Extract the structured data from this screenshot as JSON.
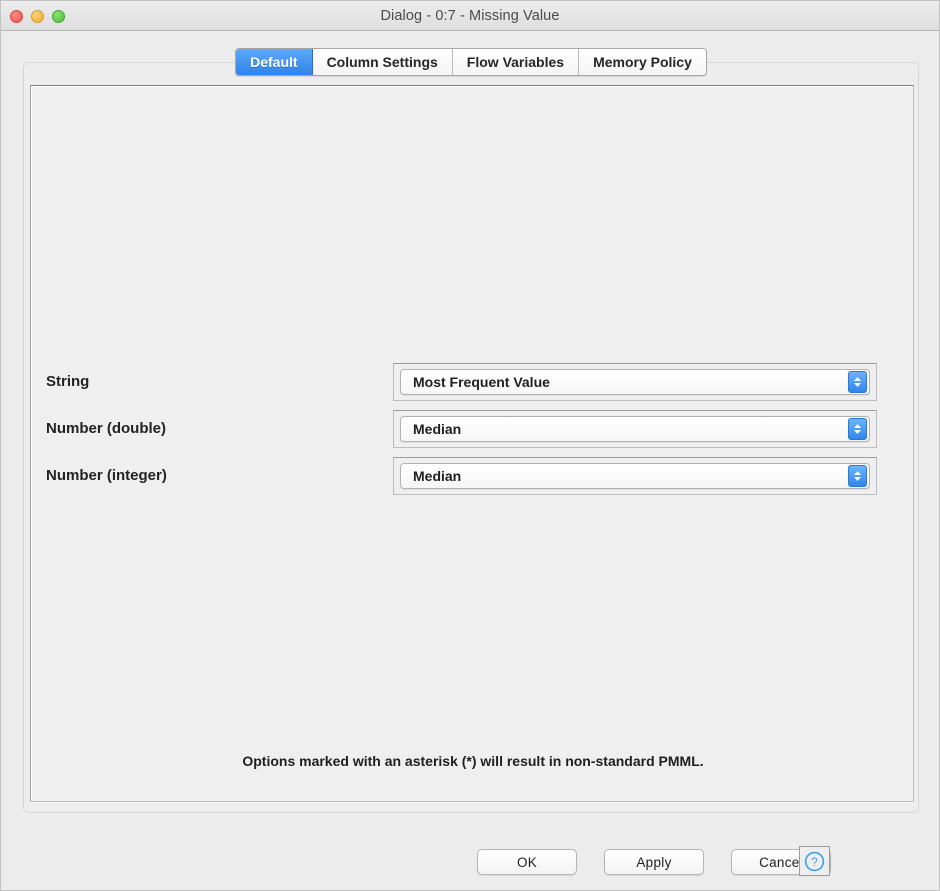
{
  "window": {
    "title": "Dialog - 0:7 - Missing Value",
    "traffic_lights": {
      "close_label": "close",
      "minimize_label": "minimize",
      "zoom_label": "zoom"
    }
  },
  "tabs": [
    {
      "label": "Default",
      "selected": true
    },
    {
      "label": "Column Settings",
      "selected": false
    },
    {
      "label": "Flow Variables",
      "selected": false
    },
    {
      "label": "Memory Policy",
      "selected": false
    }
  ],
  "settings": {
    "rows": [
      {
        "label": "String",
        "value": "Most Frequent Value"
      },
      {
        "label": "Number (double)",
        "value": "Median"
      },
      {
        "label": "Number (integer)",
        "value": "Median"
      }
    ]
  },
  "note": "Options marked with an asterisk (*) will result in non-standard PMML.",
  "buttons": {
    "ok": "OK",
    "apply": "Apply",
    "cancel": "Cancel",
    "help": "?"
  },
  "colors": {
    "accent_blue": "#2f86ee",
    "selected_tab_blue": "#2f83ec",
    "window_bg": "#ececec",
    "panel_bg": "#efefef",
    "help_blue": "#3aa0ee"
  }
}
